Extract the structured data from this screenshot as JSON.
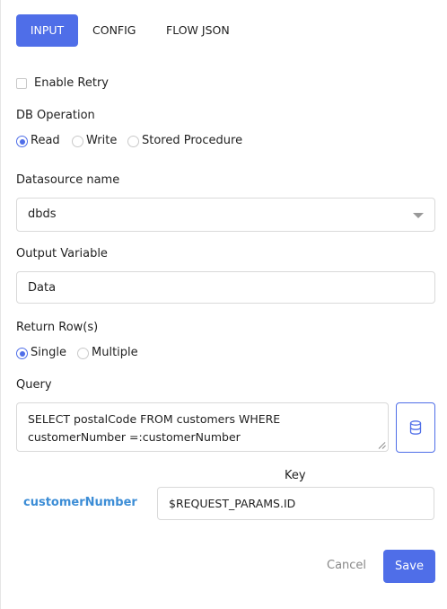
{
  "tabs": [
    {
      "label": "INPUT",
      "active": true
    },
    {
      "label": "CONFIG",
      "active": false
    },
    {
      "label": "FLOW JSON",
      "active": false
    }
  ],
  "enable_retry": {
    "label": "Enable Retry",
    "checked": false
  },
  "db_operation": {
    "label": "DB Operation",
    "options": [
      "Read",
      "Write",
      "Stored Procedure"
    ],
    "selected": "Read"
  },
  "datasource": {
    "label": "Datasource name",
    "value": "dbds"
  },
  "output_variable": {
    "label": "Output Variable",
    "value": "Data"
  },
  "return_rows": {
    "label": "Return Row(s)",
    "options": [
      "Single",
      "Multiple"
    ],
    "selected": "Single"
  },
  "query": {
    "label": "Query",
    "line1": "SELECT postalCode FROM customers WHERE",
    "line2": "customerNumber =:customerNumber"
  },
  "params": {
    "key_header": "Key",
    "rows": [
      {
        "name": "customerNumber",
        "value": "$REQUEST_PARAMS.ID"
      }
    ]
  },
  "actions": {
    "cancel": "Cancel",
    "save": "Save"
  },
  "colors": {
    "accent": "#4f6ee8",
    "param_name": "#3c8dd6"
  }
}
